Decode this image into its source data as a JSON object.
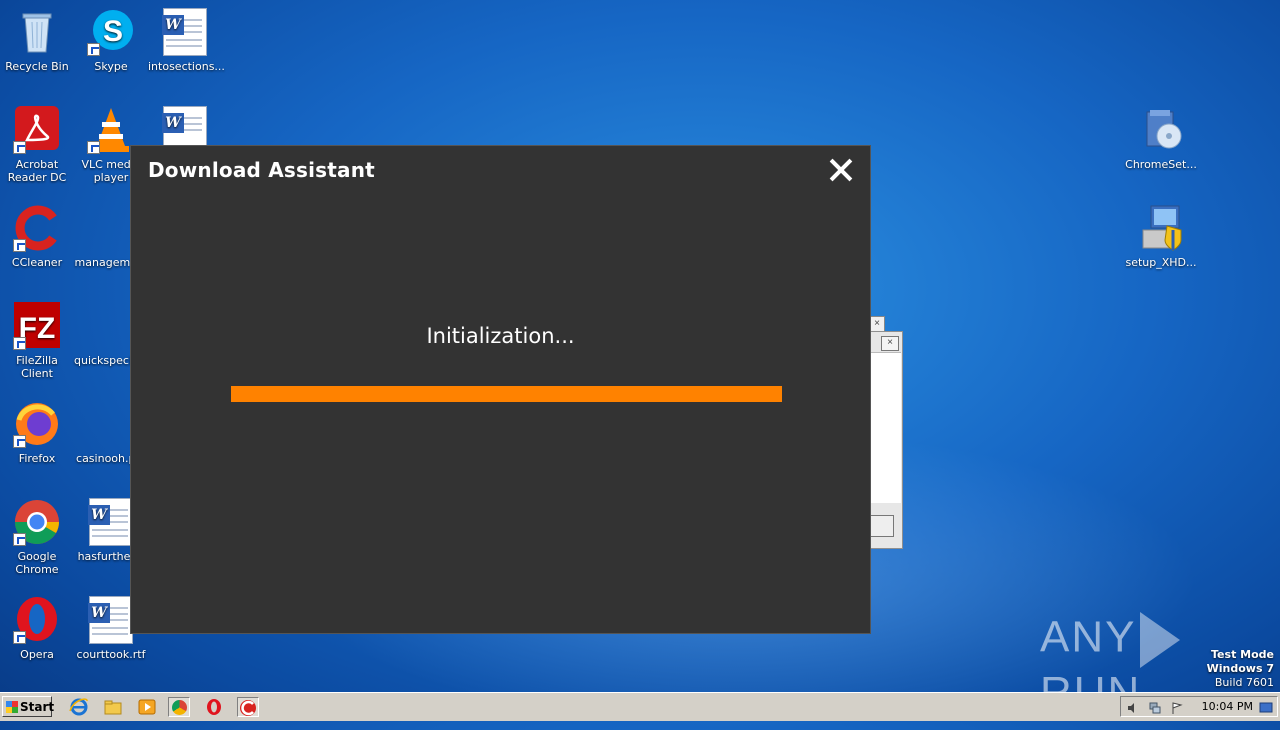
{
  "desktop": {
    "icons": [
      {
        "label": "Recycle Bin"
      },
      {
        "label": "Skype"
      },
      {
        "label": "intosections..."
      },
      {
        "label": "Acrobat\nReader DC"
      },
      {
        "label": "VLC media\nplayer"
      },
      {
        "label": "CCleaner"
      },
      {
        "label": "manageme..."
      },
      {
        "label": "FileZilla Client"
      },
      {
        "label": "quickspecie..."
      },
      {
        "label": "Firefox"
      },
      {
        "label": "casinooh.p..."
      },
      {
        "label": "Google\nChrome"
      },
      {
        "label": "hasfurther..."
      },
      {
        "label": "Opera"
      },
      {
        "label": "courttook.rtf"
      },
      {
        "label": "ChromeSet..."
      },
      {
        "label": "setup_XHD..."
      }
    ]
  },
  "dialog": {
    "title": "Download Assistant",
    "status": "Initialization...",
    "progress": 1.0,
    "accent": "#ff8200",
    "background": "#333333"
  },
  "watermark": {
    "text_left": "ANY",
    "text_right": "RUN"
  },
  "os_notice": {
    "line1": "Test Mode",
    "line2": "Windows 7",
    "line3": "Build 7601"
  },
  "taskbar": {
    "start_label": "Start",
    "clock": "10:04 PM"
  }
}
